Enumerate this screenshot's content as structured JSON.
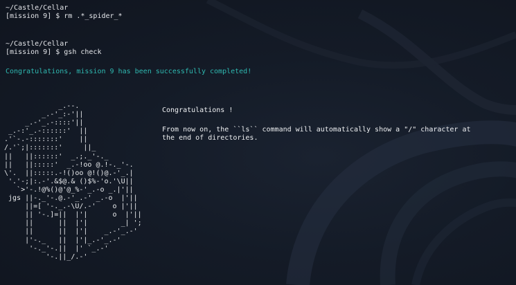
{
  "terminal": {
    "lines": {
      "path1": "~/Castle/Cellar",
      "cmd1": "[mission 9] $ rm .*_spider_*",
      "path2": "~/Castle/Cellar",
      "cmd2": "[mission 9] $ gsh check",
      "success": "Congratulations, mission 9 has been successfully completed!"
    },
    "ascii_art": "             _.--.\n         _.-'_:-'||\n     _.-'_.-::::'||\n _.-:'_.-::::::'  ||\n.'`-.-:::::::'    ||\n/.'`;|:::::::'     ||_\n||   ||::::::'  _.;._'-._\n||   ||:::::'  _.-!oo @.!-._'-.\n\\'.  ||:::::.-!()oo @!()@.-'_.|\n '.'-;|:.-'.&$@.& ()$%-'o.'\\U||\n   `>'-.!@%()@'@_%-'_.-o _.|'||\n jgs ||-._'-.@.-'_.-' _.-o  |'||\n     ||=[ '-._.-\\U/.-'    o |'||\n     || '-.]=||  |'|      o  |'||\n     ||      ||  |'|        _| ';\n     ||      ||  |'|    _.-'_.-'\n     |'-._   ||  |'|_.-'_.-'\n      '-._'-.||  |' `_.-'\n          '-.||_/.-'",
    "message": {
      "title": "Congratulations !",
      "body_line1": "From now on, the ``ls`` command will automatically show a \"/\" character at",
      "body_line2": "the end of directories."
    }
  },
  "colors": {
    "background": "#141b27",
    "text": "#e4e6ea",
    "success": "#2fb9b1"
  }
}
